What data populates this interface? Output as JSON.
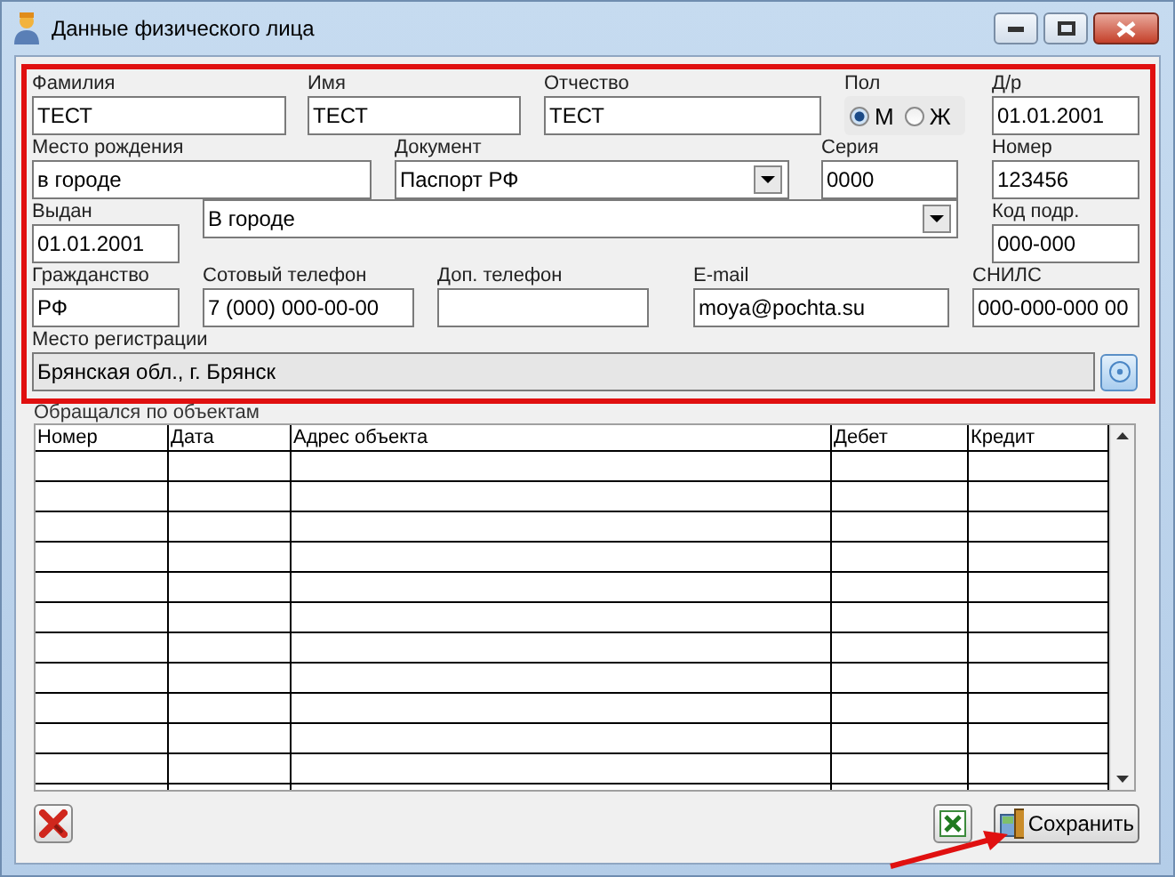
{
  "window": {
    "title": "Данные физического лица"
  },
  "form": {
    "fields": [
      {
        "kind": "text",
        "label": "Фамилия",
        "value": "ТЕСТ"
      },
      {
        "kind": "text",
        "label": "Имя",
        "value": "ТЕСТ"
      },
      {
        "kind": "text",
        "label": "Отчество",
        "value": "ТЕСТ"
      },
      {
        "kind": "radio",
        "label": "Пол",
        "options": [
          {
            "label": "М",
            "selected": true
          },
          {
            "label": "Ж",
            "selected": false
          }
        ]
      },
      {
        "kind": "text",
        "label": "Д/р",
        "value": "01.01.2001"
      },
      {
        "kind": "text",
        "label": "Место рождения",
        "value": "в городе"
      },
      {
        "kind": "combo",
        "label": "Документ",
        "value": "Паспорт РФ"
      },
      {
        "kind": "text",
        "label": "Серия",
        "value": "0000"
      },
      {
        "kind": "text",
        "label": "Номер",
        "value": "123456"
      },
      {
        "kind": "text",
        "label": "Выдан",
        "value": "01.01.2001"
      },
      {
        "kind": "combo",
        "value": "В городе"
      },
      {
        "kind": "text",
        "label": "Код подр.",
        "value": "000-000"
      },
      {
        "kind": "text",
        "label": "Гражданство",
        "value": "РФ"
      },
      {
        "kind": "text",
        "label": "Сотовый телефон",
        "value": "7 (000) 000-00-00"
      },
      {
        "kind": "text",
        "label": "Доп. телефон"
      },
      {
        "kind": "text",
        "label": "E-mail",
        "value": "moya@pochta.su"
      },
      {
        "kind": "text",
        "label": "СНИЛС",
        "value": "000-000-000 00"
      },
      {
        "kind": "lookup",
        "label": "Место регистрации",
        "value": "Брянская обл., г. Брянск",
        "readonly": true
      }
    ]
  },
  "table": {
    "title": "Обращался по объектам",
    "columns": [
      "Номер",
      "Дата",
      "Адрес объекта",
      "Дебет",
      "Кредит"
    ]
  },
  "buttons": [
    {
      "kind": "delete"
    },
    {
      "kind": "excel"
    },
    {
      "kind": "save",
      "label": "Сохранить"
    }
  ]
}
